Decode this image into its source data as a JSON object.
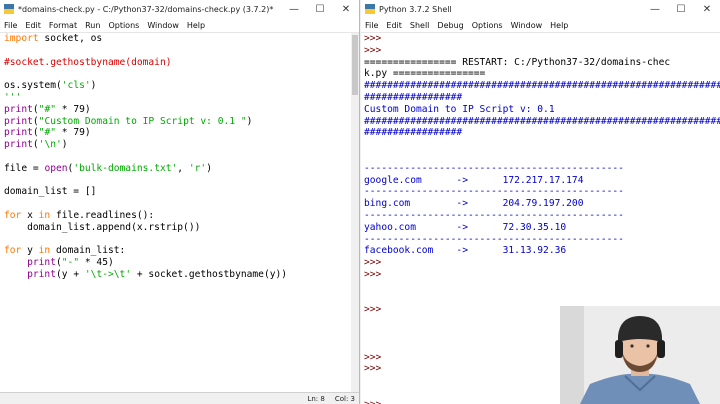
{
  "editor": {
    "title": "*domains-check.py - C:/Python37-32/domains-check.py (3.7.2)*",
    "controls": [
      "—",
      "☐",
      "✕"
    ],
    "menus": [
      "File",
      "Edit",
      "Format",
      "Run",
      "Options",
      "Window",
      "Help"
    ],
    "code": [
      [
        {
          "t": "kw",
          "s": "import"
        },
        {
          "t": "df",
          "s": " socket, os"
        }
      ],
      [],
      [
        {
          "t": "cm",
          "s": "#socket.gethostbyname(domain)"
        }
      ],
      [],
      [
        {
          "t": "df",
          "s": "os.system("
        },
        {
          "t": "st",
          "s": "'cls'"
        },
        {
          "t": "df",
          "s": ")"
        }
      ],
      [
        {
          "t": "st",
          "s": "'''"
        }
      ],
      [
        {
          "t": "bi",
          "s": "print"
        },
        {
          "t": "df",
          "s": "("
        },
        {
          "t": "st",
          "s": "\"#\""
        },
        {
          "t": "df",
          "s": " * 79)"
        }
      ],
      [
        {
          "t": "bi",
          "s": "print"
        },
        {
          "t": "df",
          "s": "("
        },
        {
          "t": "st",
          "s": "\"Custom Domain to IP Script v: 0.1 \""
        },
        {
          "t": "df",
          "s": ")"
        }
      ],
      [
        {
          "t": "bi",
          "s": "print"
        },
        {
          "t": "df",
          "s": "("
        },
        {
          "t": "st",
          "s": "\"#\""
        },
        {
          "t": "df",
          "s": " * 79)"
        }
      ],
      [
        {
          "t": "bi",
          "s": "print"
        },
        {
          "t": "df",
          "s": "("
        },
        {
          "t": "st",
          "s": "'\\n'"
        },
        {
          "t": "df",
          "s": ")"
        }
      ],
      [],
      [
        {
          "t": "df",
          "s": "file = "
        },
        {
          "t": "bi",
          "s": "open"
        },
        {
          "t": "df",
          "s": "("
        },
        {
          "t": "st",
          "s": "'bulk-domains.txt'"
        },
        {
          "t": "df",
          "s": ", "
        },
        {
          "t": "st",
          "s": "'r'"
        },
        {
          "t": "df",
          "s": ")"
        }
      ],
      [],
      [
        {
          "t": "df",
          "s": "domain_list = []"
        }
      ],
      [],
      [
        {
          "t": "kw",
          "s": "for"
        },
        {
          "t": "df",
          "s": " x "
        },
        {
          "t": "kw",
          "s": "in"
        },
        {
          "t": "df",
          "s": " file.readlines():"
        }
      ],
      [
        {
          "t": "df",
          "s": "    domain_list.append(x.rstrip())"
        }
      ],
      [],
      [
        {
          "t": "kw",
          "s": "for"
        },
        {
          "t": "df",
          "s": " y "
        },
        {
          "t": "kw",
          "s": "in"
        },
        {
          "t": "df",
          "s": " domain_list:"
        }
      ],
      [
        {
          "t": "df",
          "s": "    "
        },
        {
          "t": "bi",
          "s": "print"
        },
        {
          "t": "df",
          "s": "("
        },
        {
          "t": "st",
          "s": "\"-\""
        },
        {
          "t": "df",
          "s": " * 45)"
        }
      ],
      [
        {
          "t": "df",
          "s": "    "
        },
        {
          "t": "bi",
          "s": "print"
        },
        {
          "t": "df",
          "s": "(y + "
        },
        {
          "t": "st",
          "s": "'\\t->\\t'"
        },
        {
          "t": "df",
          "s": " + socket.gethostbyname(y))"
        }
      ]
    ],
    "status": {
      "line": "Ln: 8",
      "col": "Col: 3"
    }
  },
  "shell": {
    "title": "Python 3.7.2 Shell",
    "controls": [
      "—",
      "☐",
      "✕"
    ],
    "menus": [
      "File",
      "Edit",
      "Shell",
      "Debug",
      "Options",
      "Window",
      "Help"
    ],
    "lines": [
      {
        "t": "prompt",
        "s": ">>>"
      },
      {
        "t": "prompt",
        "s": ">>>"
      },
      {
        "t": "df",
        "s": "================ RESTART: C:/Python37-32/domains-chec"
      },
      {
        "t": "df",
        "s": "k.py ================"
      },
      {
        "t": "out",
        "s": "##############################################################"
      },
      {
        "t": "out",
        "s": "#################"
      },
      {
        "t": "out",
        "s": "Custom Domain to IP Script v: 0.1"
      },
      {
        "t": "out",
        "s": "##############################################################"
      },
      {
        "t": "out",
        "s": "#################"
      },
      {
        "t": "out",
        "s": ""
      },
      {
        "t": "out",
        "s": ""
      },
      {
        "t": "out",
        "s": "---------------------------------------------"
      },
      {
        "t": "out",
        "s": "google.com      ->      172.217.17.174"
      },
      {
        "t": "out",
        "s": "---------------------------------------------"
      },
      {
        "t": "out",
        "s": "bing.com        ->      204.79.197.200"
      },
      {
        "t": "out",
        "s": "---------------------------------------------"
      },
      {
        "t": "out",
        "s": "yahoo.com       ->      72.30.35.10"
      },
      {
        "t": "out",
        "s": "---------------------------------------------"
      },
      {
        "t": "out",
        "s": "facebook.com    ->      31.13.92.36"
      },
      {
        "t": "prompt",
        "s": ">>>"
      },
      {
        "t": "prompt",
        "s": ">>>"
      },
      {
        "t": "df",
        "s": ""
      },
      {
        "t": "df",
        "s": ""
      },
      {
        "t": "prompt",
        "s": ">>>"
      },
      {
        "t": "df",
        "s": ""
      },
      {
        "t": "df",
        "s": ""
      },
      {
        "t": "df",
        "s": ""
      },
      {
        "t": "prompt",
        "s": ">>>"
      },
      {
        "t": "prompt",
        "s": ">>>"
      },
      {
        "t": "df",
        "s": ""
      },
      {
        "t": "df",
        "s": ""
      },
      {
        "t": "prompt",
        "s": ">>>"
      }
    ]
  }
}
